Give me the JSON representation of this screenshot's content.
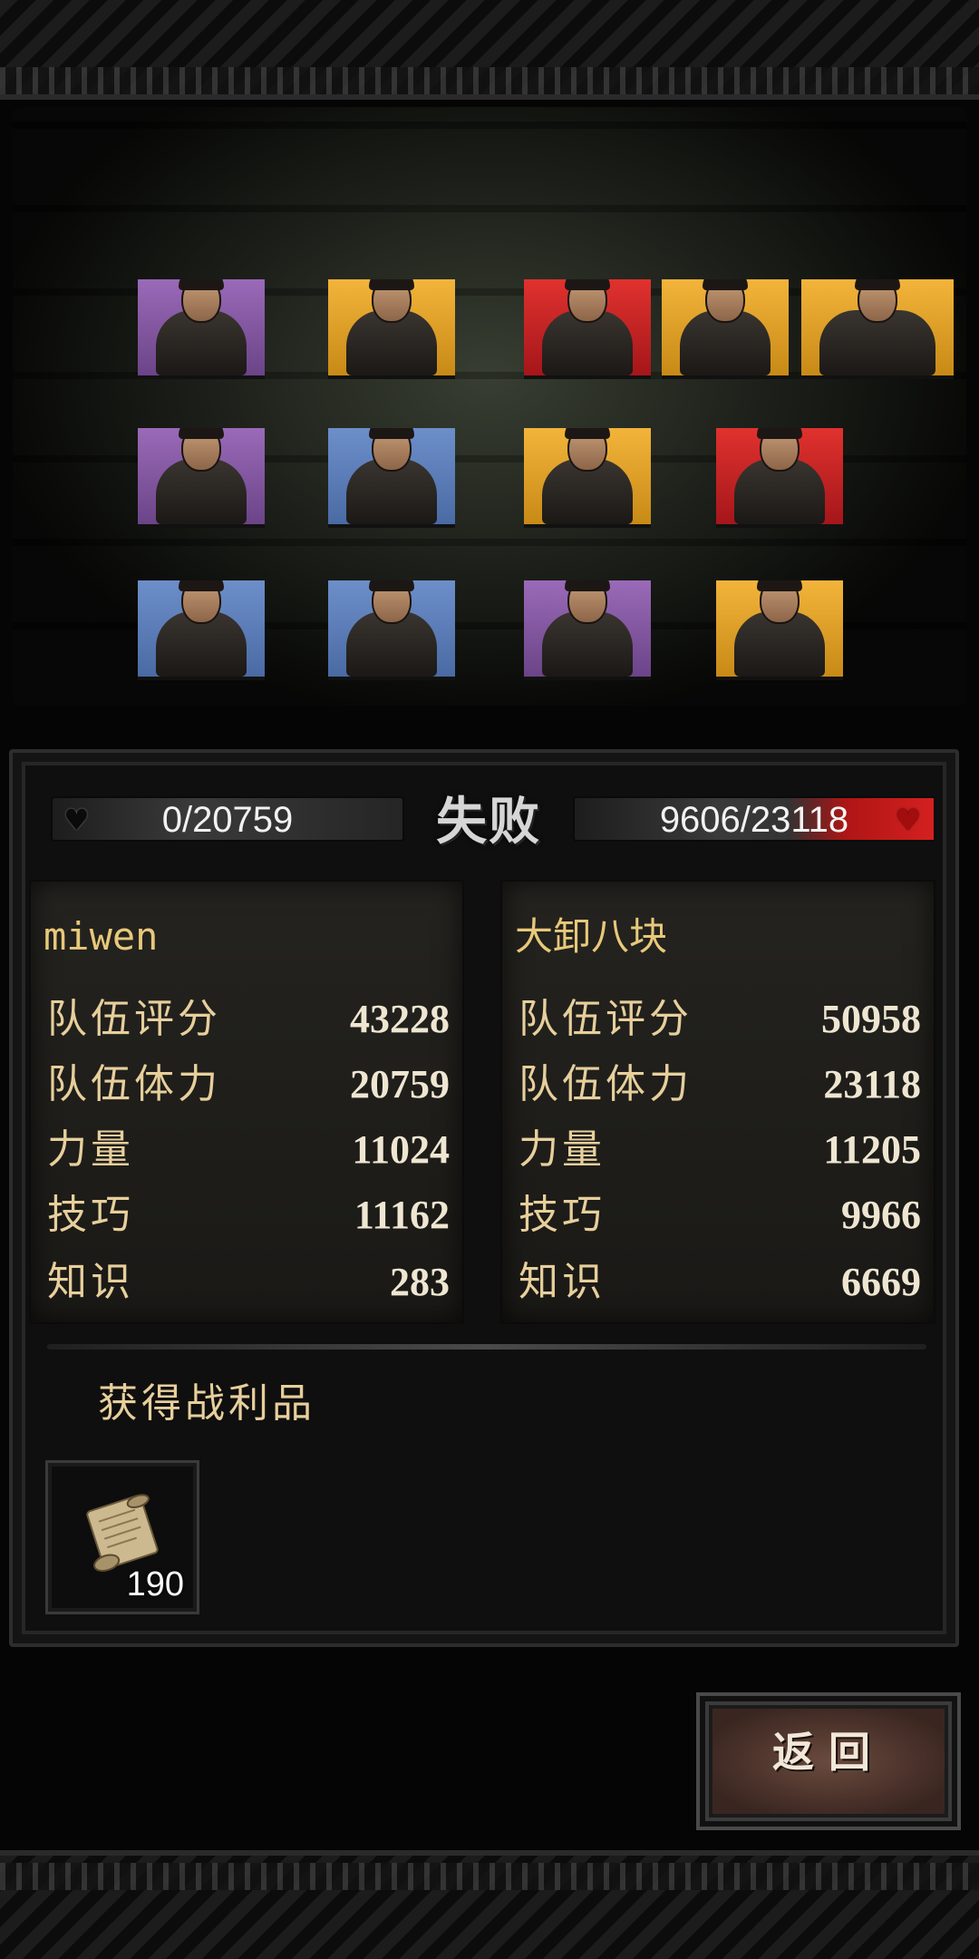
{
  "battle": {
    "result": "失败",
    "left_hp": "0/20759",
    "right_hp": "9606/23118"
  },
  "left_team": {
    "name": "miwen",
    "stats": [
      {
        "label": "队伍评分",
        "value": "43228"
      },
      {
        "label": "队伍体力",
        "value": "20759"
      },
      {
        "label": "力量",
        "value": "11024"
      },
      {
        "label": "技巧",
        "value": "11162"
      },
      {
        "label": "知识",
        "value": "283"
      }
    ]
  },
  "right_team": {
    "name": "大卸八块",
    "stats": [
      {
        "label": "队伍评分",
        "value": "50958"
      },
      {
        "label": "队伍体力",
        "value": "23118"
      },
      {
        "label": "力量",
        "value": "11205"
      },
      {
        "label": "技巧",
        "value": "9966"
      },
      {
        "label": "知识",
        "value": "6669"
      }
    ]
  },
  "loot": {
    "title": "获得战利品",
    "items": [
      {
        "icon": "scroll-icon",
        "count": "190"
      }
    ]
  },
  "buttons": {
    "return_label": "返回"
  },
  "colors": {
    "purple": "#9a6ab8",
    "yellow": "#f2b43a",
    "blue": "#6d8fc9",
    "red": "#e0322e",
    "gold_text": "#e7cf9c"
  }
}
